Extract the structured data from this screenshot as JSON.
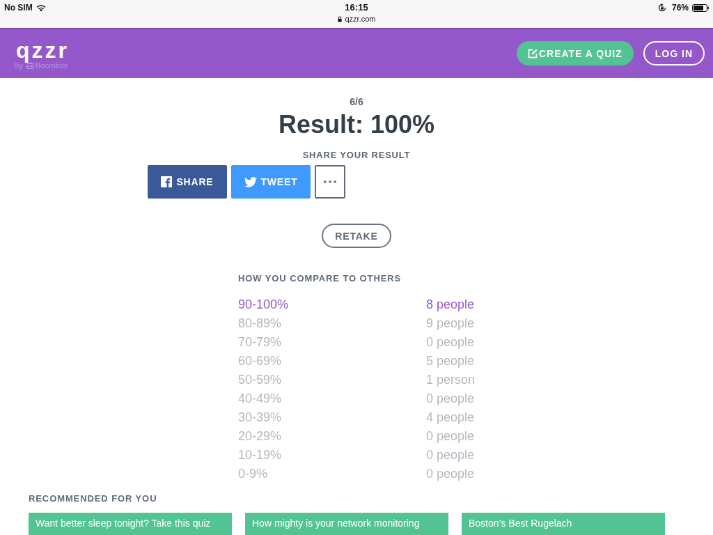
{
  "status_bar": {
    "carrier": "No SIM",
    "time": "16:15",
    "url": "qzzr.com",
    "battery": "76%"
  },
  "header": {
    "logo": "qzzr",
    "byline": "By",
    "brand": "Boombox",
    "buttons": [
      {
        "kind": "primary",
        "label": "CREATE A QUIZ"
      },
      {
        "kind": "outline",
        "label": "LOG IN"
      }
    ]
  },
  "result": {
    "score": "6/6",
    "title": "Result: 100%"
  },
  "share": {
    "heading": "SHARE YOUR RESULT",
    "buttons": [
      {
        "kind": "facebook",
        "label": "SHARE"
      },
      {
        "kind": "twitter",
        "label": "TWEET"
      },
      {
        "kind": "more"
      }
    ]
  },
  "retake": {
    "label": "RETAKE"
  },
  "compare": {
    "heading": "HOW YOU COMPARE TO OTHERS",
    "rows": [
      {
        "range": "90-100%",
        "count": "8 people",
        "selected": true
      },
      {
        "range": "80-89%",
        "count": "9 people",
        "selected": false
      },
      {
        "range": "70-79%",
        "count": "0 people",
        "selected": false
      },
      {
        "range": "60-69%",
        "count": "5 people",
        "selected": false
      },
      {
        "range": "50-59%",
        "count": "1 person",
        "selected": false
      },
      {
        "range": "40-49%",
        "count": "0 people",
        "selected": false
      },
      {
        "range": "30-39%",
        "count": "4 people",
        "selected": false
      },
      {
        "range": "20-29%",
        "count": "0 people",
        "selected": false
      },
      {
        "range": "10-19%",
        "count": "0 people",
        "selected": false
      },
      {
        "range": "0-9%",
        "count": "0 people",
        "selected": false
      }
    ]
  },
  "recommended": {
    "heading": "RECOMMENDED FOR YOU",
    "cards": [
      {
        "title": "Want better sleep tonight? Take this quiz"
      },
      {
        "title": "How mighty is your network monitoring"
      },
      {
        "title": "Boston’s Best Rugelach"
      }
    ]
  }
}
